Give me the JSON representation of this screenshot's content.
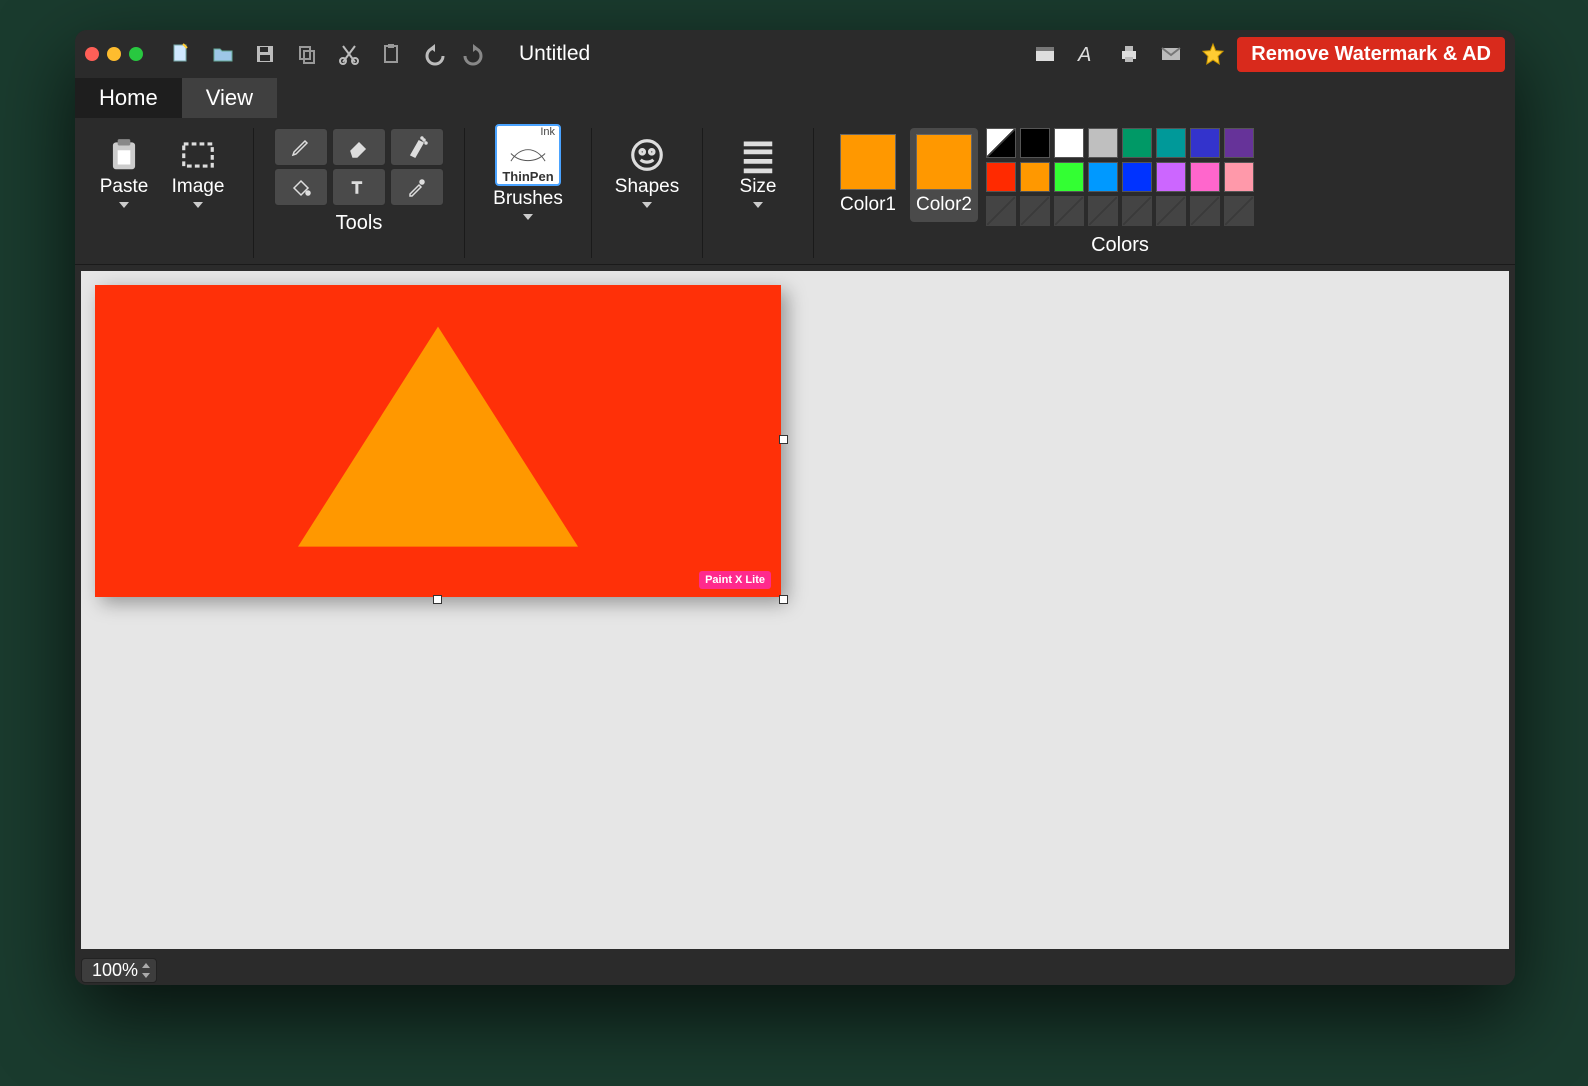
{
  "title": "Untitled",
  "remove_btn": "Remove Watermark & AD",
  "tabs": {
    "home": "Home",
    "view": "View"
  },
  "ribbon": {
    "paste": "Paste",
    "image": "Image",
    "tools_caption": "Tools",
    "brushes": "Brushes",
    "brush_ink": "Ink",
    "brush_thin": "ThinPen",
    "shapes": "Shapes",
    "size": "Size",
    "color1": "Color1",
    "color2": "Color2",
    "colors_caption": "Colors",
    "color1_value": "#ff9800",
    "color2_value": "#ff9800",
    "palette_row1": [
      "diag",
      "#000000",
      "#ffffff",
      "#bfbfbf",
      "#009966",
      "#009999",
      "#3333cc",
      "#663399"
    ],
    "palette_row2": [
      "#ff2a00",
      "#ff9800",
      "#33ff33",
      "#0099ff",
      "#0033ff",
      "#cc66ff",
      "#ff66cc",
      "#ff99aa"
    ],
    "palette_row3": [
      "empty",
      "empty",
      "empty",
      "empty",
      "empty",
      "empty",
      "empty",
      "empty"
    ]
  },
  "canvas": {
    "bg": "#ff3008",
    "shape_color": "#ff9800",
    "watermark": "Paint X Lite"
  },
  "status": {
    "zoom": "100%"
  }
}
